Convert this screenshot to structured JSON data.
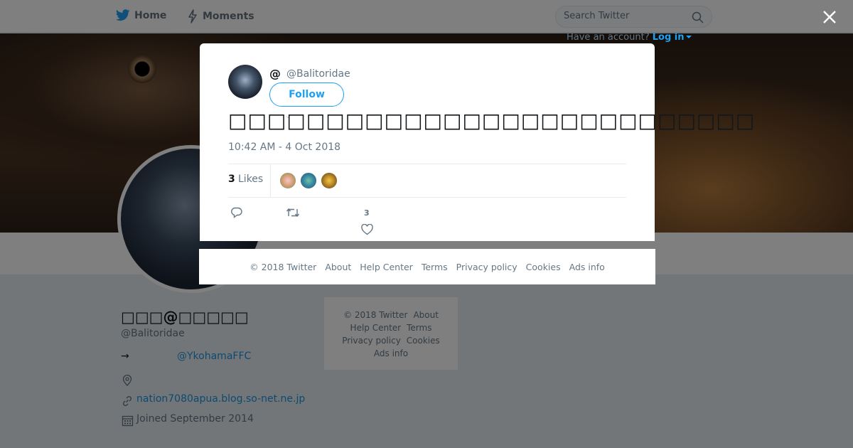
{
  "nav": {
    "home": "Home",
    "moments": "Moments",
    "search_placeholder": "Search Twitter",
    "account_prompt": "Have an account?",
    "login": "Log in"
  },
  "profile": {
    "display_name": "□□□@□□□□□",
    "handle": "@Balitoridae",
    "bio_arrow": "→",
    "bio_mention": "@YkohamaFFC",
    "url": "nation7080apua.blog.so-net.ne.jp",
    "joined": "Joined September 2014"
  },
  "side_footer": {
    "copyright": "© 2018 Twitter",
    "about": "About",
    "help": "Help Center",
    "terms": "Terms",
    "privacy": "Privacy policy",
    "cookies": "Cookies",
    "ads": "Ads info"
  },
  "tweet": {
    "author_name": "@",
    "author_handle": "@Balitoridae",
    "follow_label": "Follow",
    "text": "□□□□□□□□□□□□□□□□□□□□□□□□□□□",
    "timestamp": "10:42 AM - 4 Oct 2018",
    "likes_count": "3",
    "likes_label": "Likes",
    "like_action_count": "3"
  },
  "modal_footer": {
    "copyright": "© 2018 Twitter",
    "about": "About",
    "help": "Help Center",
    "terms": "Terms",
    "privacy": "Privacy policy",
    "cookies": "Cookies",
    "ads": "Ads info"
  },
  "colors": {
    "brand": "#1da1f2",
    "link": "#1b95e0",
    "muted": "#657786"
  },
  "icons": [
    "twitter-bird-icon",
    "lightning-icon",
    "search-icon",
    "close-icon",
    "location-icon",
    "link-icon",
    "calendar-icon",
    "reply-icon",
    "retweet-icon",
    "heart-icon"
  ]
}
